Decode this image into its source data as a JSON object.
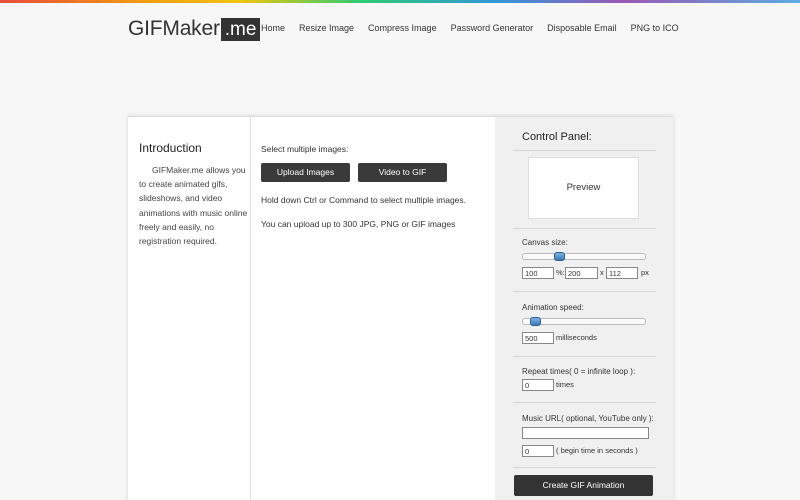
{
  "header": {
    "logo_main": "GIFMaker",
    "logo_tld": ".me",
    "nav": [
      "Home",
      "Resize Image",
      "Compress Image",
      "Password Generator",
      "Disposable Email",
      "PNG to ICO"
    ]
  },
  "intro": {
    "title": "Introduction",
    "text": "GIFMaker.me allows you to create animated gifs, slideshows, and video animations with music online freely and easily, no registration required."
  },
  "upload": {
    "label": "Select multiple images:",
    "upload_button": "Upload Images",
    "video_button": "Video to GIF",
    "note1": "Hold down Ctrl or Command to select multiple images.",
    "note2": "You can upload up to 300 JPG, PNG or GIF images"
  },
  "control_panel": {
    "title": "Control Panel:",
    "preview": "Preview",
    "canvas": {
      "label": "Canvas size:",
      "percent": "100",
      "percent_unit": "%:",
      "width": "200",
      "x_sep": "x",
      "height": "112",
      "unit": "px",
      "slider_value_pct": 27
    },
    "speed": {
      "label": "Animation speed:",
      "value": "500",
      "unit": "milliseconds",
      "slider_value_pct": 6
    },
    "repeat": {
      "label": "Repeat times( 0 = infinite loop ):",
      "value": "0",
      "unit": "times"
    },
    "music": {
      "label": "Music URL( optional, YouTube only ):",
      "url": "",
      "begin": "0",
      "begin_unit": "( begin time in seconds )"
    },
    "create_button": "Create GIF Animation"
  }
}
